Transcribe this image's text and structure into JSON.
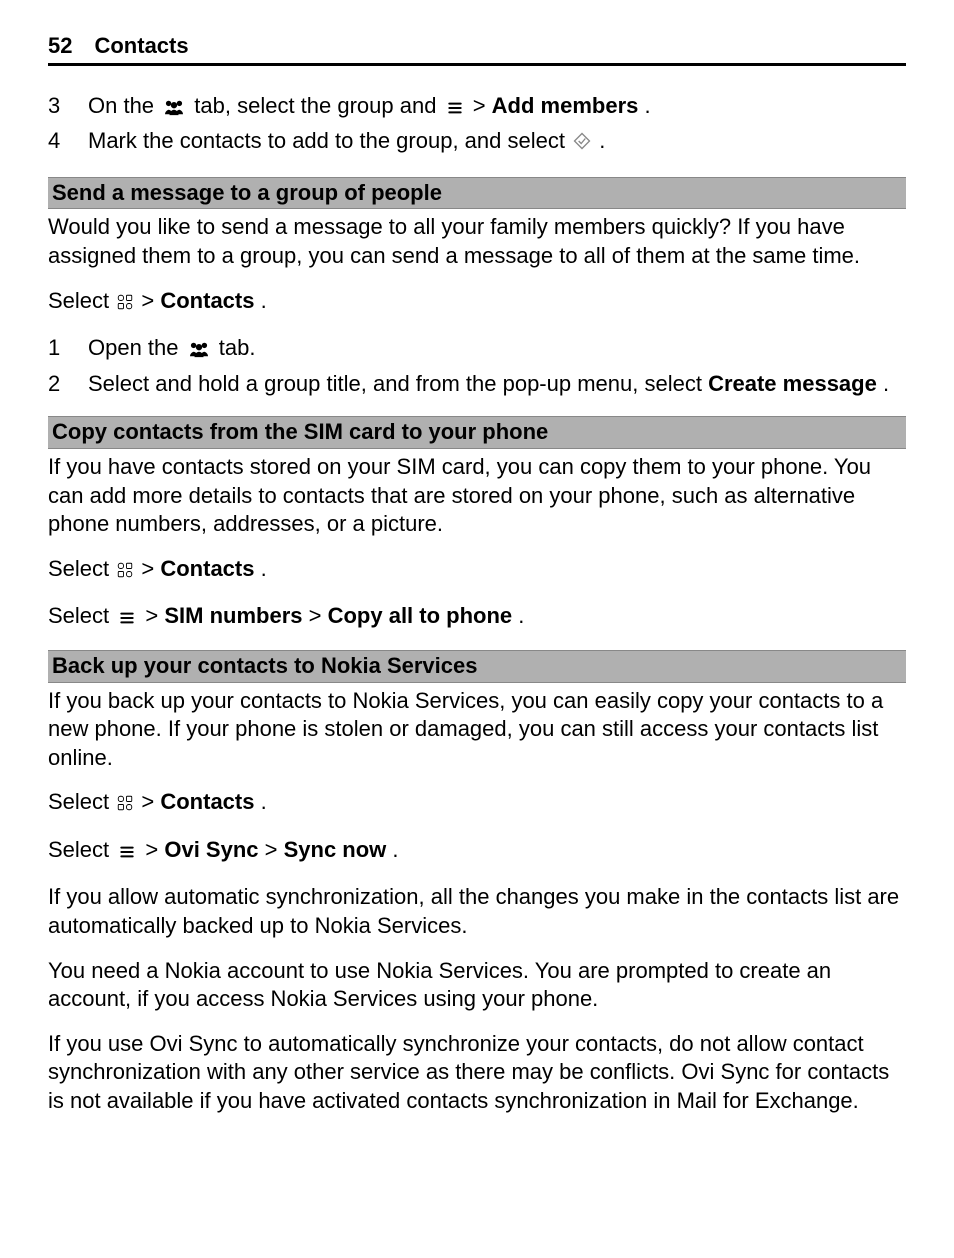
{
  "header": {
    "page_number": "52",
    "title": "Contacts"
  },
  "intro_steps": [
    {
      "n": "3",
      "parts": {
        "a": "On the ",
        "b": " tab, select the group and ",
        "c": " > ",
        "d": "Add members",
        "e": "."
      }
    },
    {
      "n": "4",
      "parts": {
        "a": "Mark the contacts to add to the group, and select ",
        "b": "."
      }
    }
  ],
  "sec1": {
    "heading": "Send a message to a group of people",
    "p1": "Would you like to send a message to all your family members quickly? If you have assigned them to a group, you can send a message to all of them at the same time.",
    "select_line": {
      "a": "Select ",
      "b": " > ",
      "c": "Contacts",
      "d": "."
    },
    "steps": [
      {
        "n": "1",
        "parts": {
          "a": "Open the ",
          "b": " tab."
        }
      },
      {
        "n": "2",
        "parts": {
          "a": "Select and hold a group title, and from the pop-up menu, select ",
          "b": "Create message",
          "c": "."
        }
      }
    ]
  },
  "sec2": {
    "heading": "Copy contacts from the SIM card to your phone",
    "p1": "If you have contacts stored on your SIM card, you can copy them to your phone. You can add more details to contacts that are stored on your phone, such as alternative phone numbers, addresses, or a picture.",
    "select_line1": {
      "a": "Select ",
      "b": " > ",
      "c": "Contacts",
      "d": "."
    },
    "select_line2": {
      "a": "Select ",
      "b": " > ",
      "c": "SIM numbers",
      "d": "  > ",
      "e": "Copy all to phone",
      "f": "."
    }
  },
  "sec3": {
    "heading": "Back up your contacts to Nokia Services",
    "p1": "If you back up your contacts to Nokia Services, you can easily copy your contacts to a new phone. If your phone is stolen or damaged, you can still access your contacts list online.",
    "select_line1": {
      "a": "Select ",
      "b": " > ",
      "c": "Contacts",
      "d": "."
    },
    "select_line2": {
      "a": "Select ",
      "b": " > ",
      "c": "Ovi Sync",
      "d": "  > ",
      "e": "Sync now",
      "f": "."
    },
    "p2": "If you allow automatic synchronization, all the changes you make in the contacts list are automatically backed up to Nokia Services.",
    "p3": "You need a Nokia account to use Nokia Services. You are prompted to create an account, if you access Nokia Services using your phone.",
    "p4": "If you use Ovi Sync to automatically synchronize your contacts, do not allow contact synchronization with any other service as there may be conflicts. Ovi Sync for contacts is not available if you have activated contacts synchronization in Mail for Exchange."
  }
}
